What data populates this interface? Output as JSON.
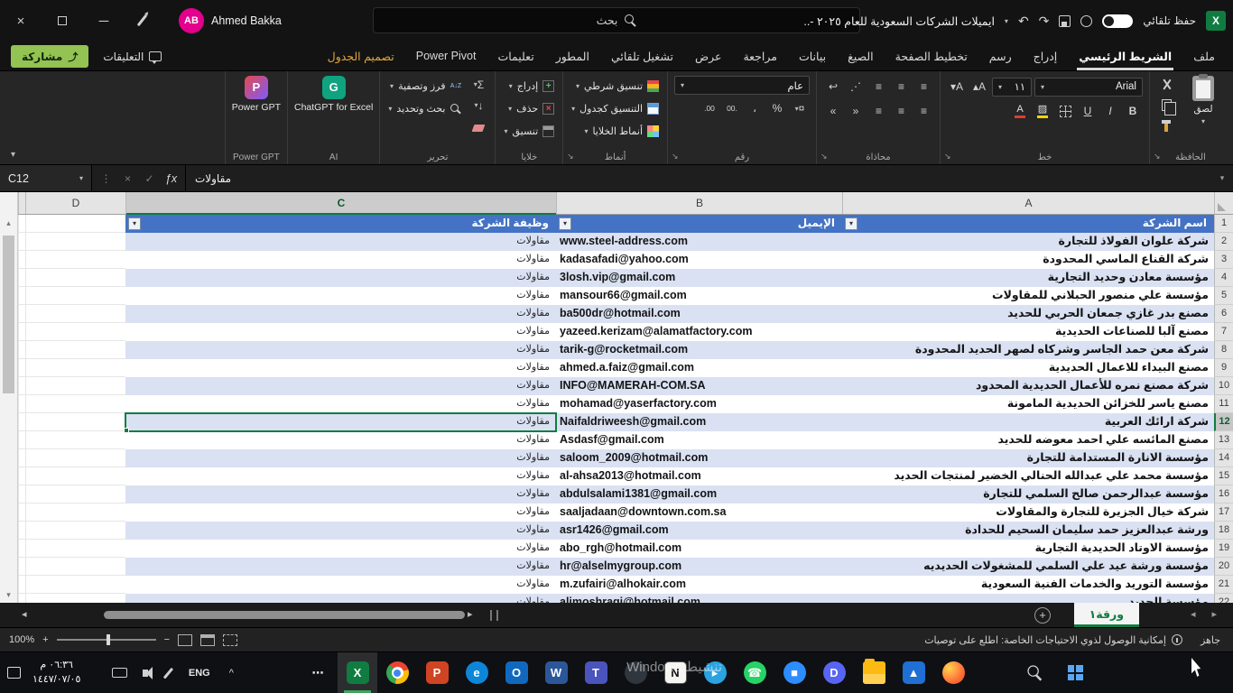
{
  "title_bar": {
    "user_name": "Ahmed Bakka",
    "user_initials": "AB",
    "search_placeholder": "بحث",
    "document_title": "ايميلات الشركات السعودية للعام ٢٠٢٥ -..",
    "autosave_label": "حفظ تلقائي"
  },
  "ribbon_tabs": {
    "share_label": "مشاركة",
    "comments_label": "التعليقات",
    "tabs": [
      {
        "label": "ملف"
      },
      {
        "label": "الشريط الرئيسي",
        "active": true
      },
      {
        "label": "إدراج"
      },
      {
        "label": "رسم"
      },
      {
        "label": "تخطيط الصفحة"
      },
      {
        "label": "الصيغ"
      },
      {
        "label": "بيانات"
      },
      {
        "label": "مراجعة"
      },
      {
        "label": "عرض"
      },
      {
        "label": "تشغيل تلقائي"
      },
      {
        "label": "المطور"
      },
      {
        "label": "تعليمات"
      },
      {
        "label": "Power Pivot"
      },
      {
        "label": "تصميم الجدول",
        "contextual": true
      }
    ]
  },
  "ribbon": {
    "clipboard": {
      "group": "الحافظة",
      "paste_label": "لصق"
    },
    "font": {
      "group": "خط",
      "font_name": "Arial",
      "font_size": "١١"
    },
    "alignment": {
      "group": "محاذاة"
    },
    "number": {
      "group": "رقم",
      "format": "عام"
    },
    "styles": {
      "group": "أنماط",
      "items": [
        "تنسيق شرطي",
        "التنسيق كجدول",
        "أنماط الخلايا"
      ]
    },
    "cells": {
      "group": "خلايا",
      "items": [
        "إدراج",
        "حذف",
        "تنسيق"
      ]
    },
    "editing": {
      "group": "تحرير",
      "items": [
        "فرز وتصفية",
        "بحث وتحديد"
      ]
    },
    "ai": {
      "group": "AI",
      "button_label": "ChatGPT for Excel"
    },
    "powergpt": {
      "group": "Power GPT",
      "button_label": "Power GPT"
    }
  },
  "formula_bar": {
    "name_box": "C12",
    "value": "مقاولات"
  },
  "grid": {
    "selected_cell": "C12",
    "columns": [
      {
        "letter": "D"
      },
      {
        "letter": "C",
        "selected": true
      },
      {
        "letter": "B"
      },
      {
        "letter": "A"
      }
    ],
    "header_row": {
      "n": "1",
      "A": "اسم الشركة",
      "B": "الإيميل",
      "C": "وظيفة الشركة"
    },
    "rows": [
      {
        "n": 2,
        "A": "شركة علوان الفولاذ للتجارة",
        "B": "www.steel-address.com",
        "C": "مقاولات"
      },
      {
        "n": 3,
        "A": "شركة القناع الماسي المحدودة",
        "B": "kadasafadi@yahoo.com",
        "C": "مقاولات"
      },
      {
        "n": 4,
        "A": "مؤسسة معادن وحديد التجارية",
        "B": "3losh.vip@gmail.com",
        "C": "مقاولات"
      },
      {
        "n": 5,
        "A": "مؤسسة علي منصور الحبلاني للمقاولات",
        "B": "mansour66@gmail.com",
        "C": "مقاولات"
      },
      {
        "n": 6,
        "A": "مصنع بدر غازي جمعان الحربي للحديد",
        "B": "ba500dr@hotmail.com",
        "C": "مقاولات"
      },
      {
        "n": 7,
        "A": "مصنع آلبا للصناعات الحديدية",
        "B": "yazeed.kerizam@alamatfactory.com",
        "C": "مقاولات"
      },
      {
        "n": 8,
        "A": "شركة معن حمد الجاسر وشركاه لصهر الحديد المحدودة",
        "B": "tarik-g@rocketmail.com",
        "C": "مقاولات"
      },
      {
        "n": 9,
        "A": "مصنع البيداء للاعمال الحديدية",
        "B": "ahmed.a.faiz@gmail.com",
        "C": "مقاولات"
      },
      {
        "n": 10,
        "A": "شركة مصنع نمره للأعمال الحديدية المحدود",
        "B": "INFO@MAMERAH-COM.SA",
        "C": "مقاولات"
      },
      {
        "n": 11,
        "A": "مصنع ياسر للخزائن الحديدية المامونة",
        "B": "mohamad@yaserfactory.com",
        "C": "مقاولات"
      },
      {
        "n": 12,
        "A": "شركة ارائك العربية",
        "B": "Naifaldriweesh@gmail.com",
        "C": "مقاولات"
      },
      {
        "n": 13,
        "A": "مصنع المائسه علي احمد معوضه للحديد",
        "B": "Asdasf@gmail.com",
        "C": "مقاولات"
      },
      {
        "n": 14,
        "A": "مؤسسة الانارة المستدامة للتجارة",
        "B": "saloom_2009@hotmail.com",
        "C": "مقاولات"
      },
      {
        "n": 15,
        "A": "مؤسسة محمد علي عبدالله الحنالي الخضير لمنتجات الحديد",
        "B": "al-ahsa2013@hotmail.com",
        "C": "مقاولات"
      },
      {
        "n": 16,
        "A": "مؤسسة عبدالرحمن صالح السلمي للتجارة",
        "B": "abdulsalami1381@gmail.com",
        "C": "مقاولات"
      },
      {
        "n": 17,
        "A": "شركة خيال الجزيرة للتجارة والمقاولات",
        "B": "saaljadaan@downtown.com.sa",
        "C": "مقاولات"
      },
      {
        "n": 18,
        "A": "ورشة عبدالعزيز حمد سليمان السحيم للحدادة",
        "B": "asr1426@gmail.com",
        "C": "مقاولات"
      },
      {
        "n": 19,
        "A": "مؤسسة الاوتاد الحديدية التجارية",
        "B": "abo_rgh@hotmail.com",
        "C": "مقاولات"
      },
      {
        "n": 20,
        "A": "مؤسسة ورشة عيد علي السلمي للمشغولات الحديديه",
        "B": "hr@alselmygroup.com",
        "C": "مقاولات"
      },
      {
        "n": 21,
        "A": "مؤسسة التوريد والخدمات الفنية السعودية",
        "B": "m.zufairi@alhokair.com",
        "C": "مقاولات"
      },
      {
        "n": 22,
        "A": "مؤسسة الحديد",
        "B": "alimoshragi@hotmail.com",
        "C": "مقاولات"
      }
    ]
  },
  "sheet_bar": {
    "active_sheet": "ورقة١"
  },
  "status_bar": {
    "ready": "جاهز",
    "zoom": "100%",
    "accessibility": "إمكانية الوصول لذوي الاحتياجات الخاصة: اطلع على توصيات"
  },
  "taskbar": {
    "time": "٠٦:٣٦ م",
    "date": "١٤٤٧/٠٧/٠٥",
    "language": "ENG",
    "watermark": "تنشيط Windows",
    "apps": [
      {
        "name": "overflow",
        "glyph": "⋯",
        "shape": "none",
        "fg": "#e8e8e8"
      },
      {
        "name": "excel",
        "glyph": "X",
        "shape": "square",
        "color": "#107c41",
        "fg": "#ffffff",
        "active": true
      },
      {
        "name": "chrome",
        "shape": "circle"
      },
      {
        "name": "powerpoint",
        "glyph": "P",
        "shape": "square",
        "color": "#d04423",
        "fg": "#ffffff"
      },
      {
        "name": "edge",
        "glyph": "e",
        "shape": "circle",
        "color": "#0d86d8",
        "fg": "#ffffff"
      },
      {
        "name": "outlook",
        "glyph": "O",
        "shape": "square",
        "color": "#1069bf",
        "fg": "#ffffff"
      },
      {
        "name": "word",
        "glyph": "W",
        "shape": "square",
        "color": "#2b579a",
        "fg": "#ffffff"
      },
      {
        "name": "teams",
        "glyph": "T",
        "shape": "square",
        "color": "#4b53bc",
        "fg": "#ffffff"
      },
      {
        "name": "github",
        "glyph": "",
        "shape": "circle",
        "color": "#30363d"
      },
      {
        "name": "notion",
        "glyph": "N",
        "shape": "square",
        "color": "#f5f4f0",
        "fg": "#111111"
      },
      {
        "name": "telegram",
        "glyph": "▸",
        "shape": "circle",
        "color": "#2aa3e0",
        "fg": "#ffffff"
      },
      {
        "name": "whatsapp",
        "glyph": "☎",
        "shape": "circle",
        "color": "#25d366",
        "fg": "#ffffff"
      },
      {
        "name": "zoom",
        "glyph": "■",
        "shape": "circle",
        "color": "#2d8cff",
        "fg": "#ffffff"
      },
      {
        "name": "discord",
        "glyph": "D",
        "shape": "circle",
        "color": "#5865f2",
        "fg": "#ffffff"
      },
      {
        "name": "explorer",
        "shape": "square"
      },
      {
        "name": "photos",
        "glyph": "▲",
        "shape": "square",
        "color": "#1f6fd4",
        "fg": "#ffffff"
      },
      {
        "name": "firefox",
        "shape": "circle"
      }
    ]
  }
}
